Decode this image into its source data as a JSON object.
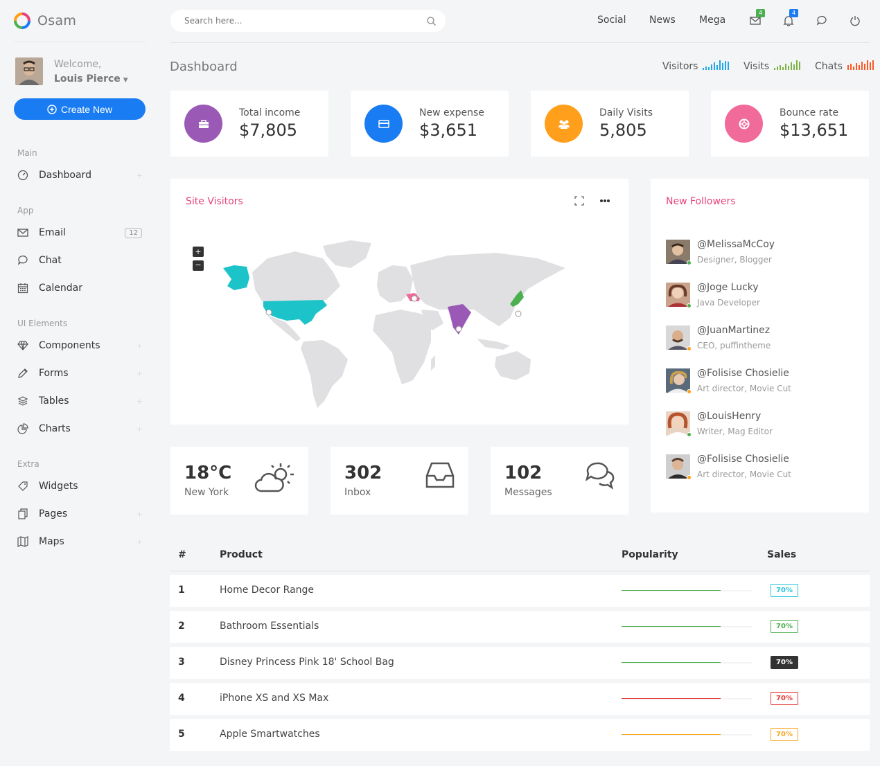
{
  "brand": {
    "name": "Osam"
  },
  "user": {
    "welcome": "Welcome,",
    "name": "Louis Pierce"
  },
  "create_label": "Create New",
  "sidebar": {
    "sections": [
      {
        "title": "Main",
        "items": [
          {
            "label": "Dashboard",
            "icon": "dashboard-icon",
            "expand": "+"
          }
        ]
      },
      {
        "title": "App",
        "items": [
          {
            "label": "Email",
            "icon": "mail-icon",
            "badge": "12"
          },
          {
            "label": "Chat",
            "icon": "chat-icon"
          },
          {
            "label": "Calendar",
            "icon": "calendar-icon"
          }
        ]
      },
      {
        "title": "UI Elements",
        "items": [
          {
            "label": "Components",
            "icon": "diamond-icon",
            "expand": "+"
          },
          {
            "label": "Forms",
            "icon": "pencil-icon",
            "expand": "+"
          },
          {
            "label": "Tables",
            "icon": "layers-icon",
            "expand": "+"
          },
          {
            "label": "Charts",
            "icon": "pie-icon",
            "expand": "+"
          }
        ]
      },
      {
        "title": "Extra",
        "items": [
          {
            "label": "Widgets",
            "icon": "tag-icon"
          },
          {
            "label": "Pages",
            "icon": "copy-icon",
            "expand": "+"
          },
          {
            "label": "Maps",
            "icon": "map-icon",
            "expand": "+"
          }
        ]
      }
    ]
  },
  "search": {
    "placeholder": "Search here..."
  },
  "topnav": {
    "links": [
      "Social",
      "News",
      "Mega"
    ],
    "mail_badge": "4",
    "bell_badge": "4"
  },
  "page_title": "Dashboard",
  "sparks": {
    "visitors": "Visitors",
    "visits": "Visits",
    "chats": "Chats",
    "colors": {
      "visitors": "#1ea7e8",
      "visits": "#7cb342",
      "chats": "#ff5722"
    }
  },
  "stats": [
    {
      "label": "Total income",
      "value": "$7,805",
      "color": "#9b59b6",
      "icon": "briefcase-icon"
    },
    {
      "label": "New expense",
      "value": "$3,651",
      "color": "#1a7cf2",
      "icon": "card-icon"
    },
    {
      "label": "Daily Visits",
      "value": "5,805",
      "color": "#ff9f1c",
      "icon": "users-icon"
    },
    {
      "label": "Bounce rate",
      "value": "$13,651",
      "color": "#f06a9a",
      "icon": "lifebuoy-icon"
    }
  ],
  "site_visitors": {
    "title": "Site Visitors",
    "zoom_in": "+",
    "zoom_out": "−"
  },
  "followers": {
    "title": "New Followers",
    "items": [
      {
        "handle": "@MelissaMcCoy",
        "role": "Designer, Blogger",
        "status": "#4caf50"
      },
      {
        "handle": "@Joge Lucky",
        "role": "Java Developer",
        "status": "#4caf50"
      },
      {
        "handle": "@JuanMartinez",
        "role": "CEO, puffintheme",
        "status": "#ff9f1c"
      },
      {
        "handle": "@Folisise Chosielie",
        "role": "Art director, Movie Cut",
        "status": "#ff9f1c"
      },
      {
        "handle": "@LouisHenry",
        "role": "Writer, Mag Editor",
        "status": "#4caf50"
      },
      {
        "handle": "@Folisise Chosielie",
        "role": "Art director, Movie Cut",
        "status": "#ff9f1c"
      }
    ]
  },
  "widgets": [
    {
      "value": "18°C",
      "label": "New York",
      "icon": "cloud-sun-icon"
    },
    {
      "value": "302",
      "label": "Inbox",
      "icon": "inbox-icon"
    },
    {
      "value": "102",
      "label": "Messages",
      "icon": "messages-icon"
    }
  ],
  "table": {
    "headers": {
      "num": "#",
      "product": "Product",
      "popularity": "Popularity",
      "sales": "Sales"
    },
    "rows": [
      {
        "n": "1",
        "product": "Home Decor Range",
        "popularity": 0.76,
        "sales": "70%",
        "color": "#26c6da",
        "bar": "#4caf50",
        "solid": false
      },
      {
        "n": "2",
        "product": "Bathroom Essentials",
        "popularity": 0.76,
        "sales": "70%",
        "color": "#4caf50",
        "bar": "#4caf50",
        "solid": false
      },
      {
        "n": "3",
        "product": "Disney Princess Pink 18' School Bag",
        "popularity": 0.76,
        "sales": "70%",
        "color": "#333333",
        "bar": "#4caf50",
        "solid": true
      },
      {
        "n": "4",
        "product": "iPhone XS and XS Max",
        "popularity": 0.76,
        "sales": "70%",
        "color": "#e53935",
        "bar": "#e53935",
        "solid": false
      },
      {
        "n": "5",
        "product": "Apple Smartwatches",
        "popularity": 0.76,
        "sales": "70%",
        "color": "#f5a623",
        "bar": "#f5a623",
        "solid": false
      }
    ]
  }
}
